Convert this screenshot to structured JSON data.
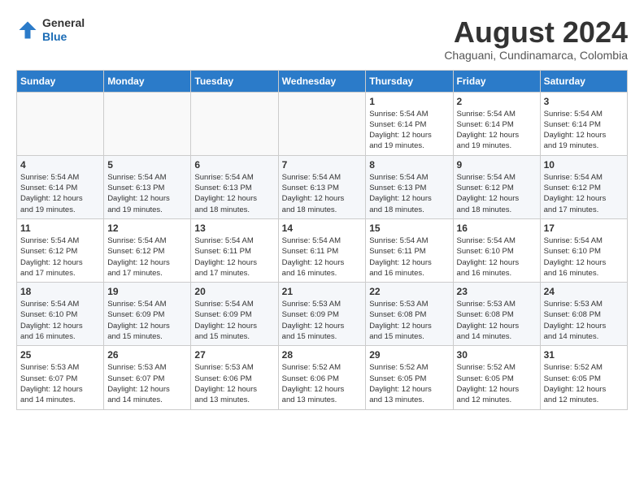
{
  "header": {
    "logo_line1": "General",
    "logo_line2": "Blue",
    "month_title": "August 2024",
    "location": "Chaguani, Cundinamarca, Colombia"
  },
  "days_of_week": [
    "Sunday",
    "Monday",
    "Tuesday",
    "Wednesday",
    "Thursday",
    "Friday",
    "Saturday"
  ],
  "weeks": [
    [
      {
        "day": "",
        "info": ""
      },
      {
        "day": "",
        "info": ""
      },
      {
        "day": "",
        "info": ""
      },
      {
        "day": "",
        "info": ""
      },
      {
        "day": "1",
        "info": "Sunrise: 5:54 AM\nSunset: 6:14 PM\nDaylight: 12 hours\nand 19 minutes."
      },
      {
        "day": "2",
        "info": "Sunrise: 5:54 AM\nSunset: 6:14 PM\nDaylight: 12 hours\nand 19 minutes."
      },
      {
        "day": "3",
        "info": "Sunrise: 5:54 AM\nSunset: 6:14 PM\nDaylight: 12 hours\nand 19 minutes."
      }
    ],
    [
      {
        "day": "4",
        "info": "Sunrise: 5:54 AM\nSunset: 6:14 PM\nDaylight: 12 hours\nand 19 minutes."
      },
      {
        "day": "5",
        "info": "Sunrise: 5:54 AM\nSunset: 6:13 PM\nDaylight: 12 hours\nand 19 minutes."
      },
      {
        "day": "6",
        "info": "Sunrise: 5:54 AM\nSunset: 6:13 PM\nDaylight: 12 hours\nand 18 minutes."
      },
      {
        "day": "7",
        "info": "Sunrise: 5:54 AM\nSunset: 6:13 PM\nDaylight: 12 hours\nand 18 minutes."
      },
      {
        "day": "8",
        "info": "Sunrise: 5:54 AM\nSunset: 6:13 PM\nDaylight: 12 hours\nand 18 minutes."
      },
      {
        "day": "9",
        "info": "Sunrise: 5:54 AM\nSunset: 6:12 PM\nDaylight: 12 hours\nand 18 minutes."
      },
      {
        "day": "10",
        "info": "Sunrise: 5:54 AM\nSunset: 6:12 PM\nDaylight: 12 hours\nand 17 minutes."
      }
    ],
    [
      {
        "day": "11",
        "info": "Sunrise: 5:54 AM\nSunset: 6:12 PM\nDaylight: 12 hours\nand 17 minutes."
      },
      {
        "day": "12",
        "info": "Sunrise: 5:54 AM\nSunset: 6:12 PM\nDaylight: 12 hours\nand 17 minutes."
      },
      {
        "day": "13",
        "info": "Sunrise: 5:54 AM\nSunset: 6:11 PM\nDaylight: 12 hours\nand 17 minutes."
      },
      {
        "day": "14",
        "info": "Sunrise: 5:54 AM\nSunset: 6:11 PM\nDaylight: 12 hours\nand 16 minutes."
      },
      {
        "day": "15",
        "info": "Sunrise: 5:54 AM\nSunset: 6:11 PM\nDaylight: 12 hours\nand 16 minutes."
      },
      {
        "day": "16",
        "info": "Sunrise: 5:54 AM\nSunset: 6:10 PM\nDaylight: 12 hours\nand 16 minutes."
      },
      {
        "day": "17",
        "info": "Sunrise: 5:54 AM\nSunset: 6:10 PM\nDaylight: 12 hours\nand 16 minutes."
      }
    ],
    [
      {
        "day": "18",
        "info": "Sunrise: 5:54 AM\nSunset: 6:10 PM\nDaylight: 12 hours\nand 16 minutes."
      },
      {
        "day": "19",
        "info": "Sunrise: 5:54 AM\nSunset: 6:09 PM\nDaylight: 12 hours\nand 15 minutes."
      },
      {
        "day": "20",
        "info": "Sunrise: 5:54 AM\nSunset: 6:09 PM\nDaylight: 12 hours\nand 15 minutes."
      },
      {
        "day": "21",
        "info": "Sunrise: 5:53 AM\nSunset: 6:09 PM\nDaylight: 12 hours\nand 15 minutes."
      },
      {
        "day": "22",
        "info": "Sunrise: 5:53 AM\nSunset: 6:08 PM\nDaylight: 12 hours\nand 15 minutes."
      },
      {
        "day": "23",
        "info": "Sunrise: 5:53 AM\nSunset: 6:08 PM\nDaylight: 12 hours\nand 14 minutes."
      },
      {
        "day": "24",
        "info": "Sunrise: 5:53 AM\nSunset: 6:08 PM\nDaylight: 12 hours\nand 14 minutes."
      }
    ],
    [
      {
        "day": "25",
        "info": "Sunrise: 5:53 AM\nSunset: 6:07 PM\nDaylight: 12 hours\nand 14 minutes."
      },
      {
        "day": "26",
        "info": "Sunrise: 5:53 AM\nSunset: 6:07 PM\nDaylight: 12 hours\nand 14 minutes."
      },
      {
        "day": "27",
        "info": "Sunrise: 5:53 AM\nSunset: 6:06 PM\nDaylight: 12 hours\nand 13 minutes."
      },
      {
        "day": "28",
        "info": "Sunrise: 5:52 AM\nSunset: 6:06 PM\nDaylight: 12 hours\nand 13 minutes."
      },
      {
        "day": "29",
        "info": "Sunrise: 5:52 AM\nSunset: 6:05 PM\nDaylight: 12 hours\nand 13 minutes."
      },
      {
        "day": "30",
        "info": "Sunrise: 5:52 AM\nSunset: 6:05 PM\nDaylight: 12 hours\nand 12 minutes."
      },
      {
        "day": "31",
        "info": "Sunrise: 5:52 AM\nSunset: 6:05 PM\nDaylight: 12 hours\nand 12 minutes."
      }
    ]
  ]
}
